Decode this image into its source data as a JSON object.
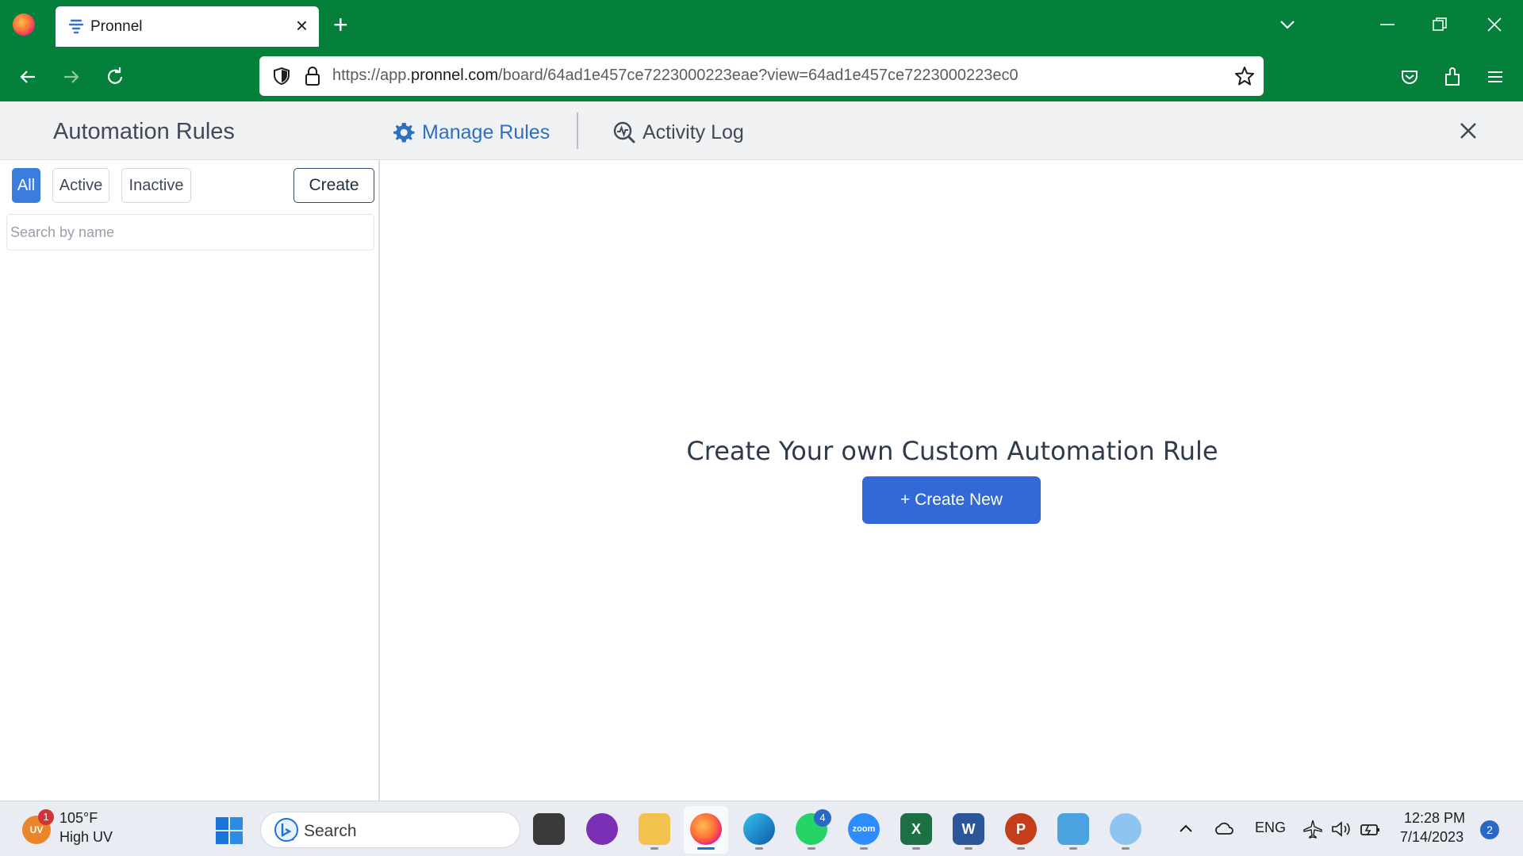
{
  "browser": {
    "tab_title": "Pronnel",
    "url_prefix": "https://app.",
    "url_host": "pronnel.com",
    "url_path": "/board/64ad1e457ce7223000223eae?view=64ad1e457ce7223000223ec0",
    "accent_color": "#05803a"
  },
  "header": {
    "title": "Automation Rules",
    "manage_rules": "Manage Rules",
    "activity_log": "Activity Log"
  },
  "sidebar": {
    "filters": [
      {
        "label": "All",
        "selected": true
      },
      {
        "label": "Active",
        "selected": false
      },
      {
        "label": "Inactive",
        "selected": false
      }
    ],
    "create_label": "Create",
    "search_placeholder": "Search by name"
  },
  "main": {
    "empty_title": "Create Your own Custom Automation Rule",
    "create_new_label": "+ Create New",
    "button_color": "#3369d6"
  },
  "taskbar": {
    "weather_badge": "1",
    "weather_icon_text": "UV",
    "weather_temp": "105°F",
    "weather_desc": "High UV",
    "search_label": "Search",
    "whatsapp_badge": "4",
    "zoom_label": "zoom",
    "language": "ENG",
    "time": "12:28 PM",
    "date": "7/14/2023",
    "notifications": "2"
  }
}
